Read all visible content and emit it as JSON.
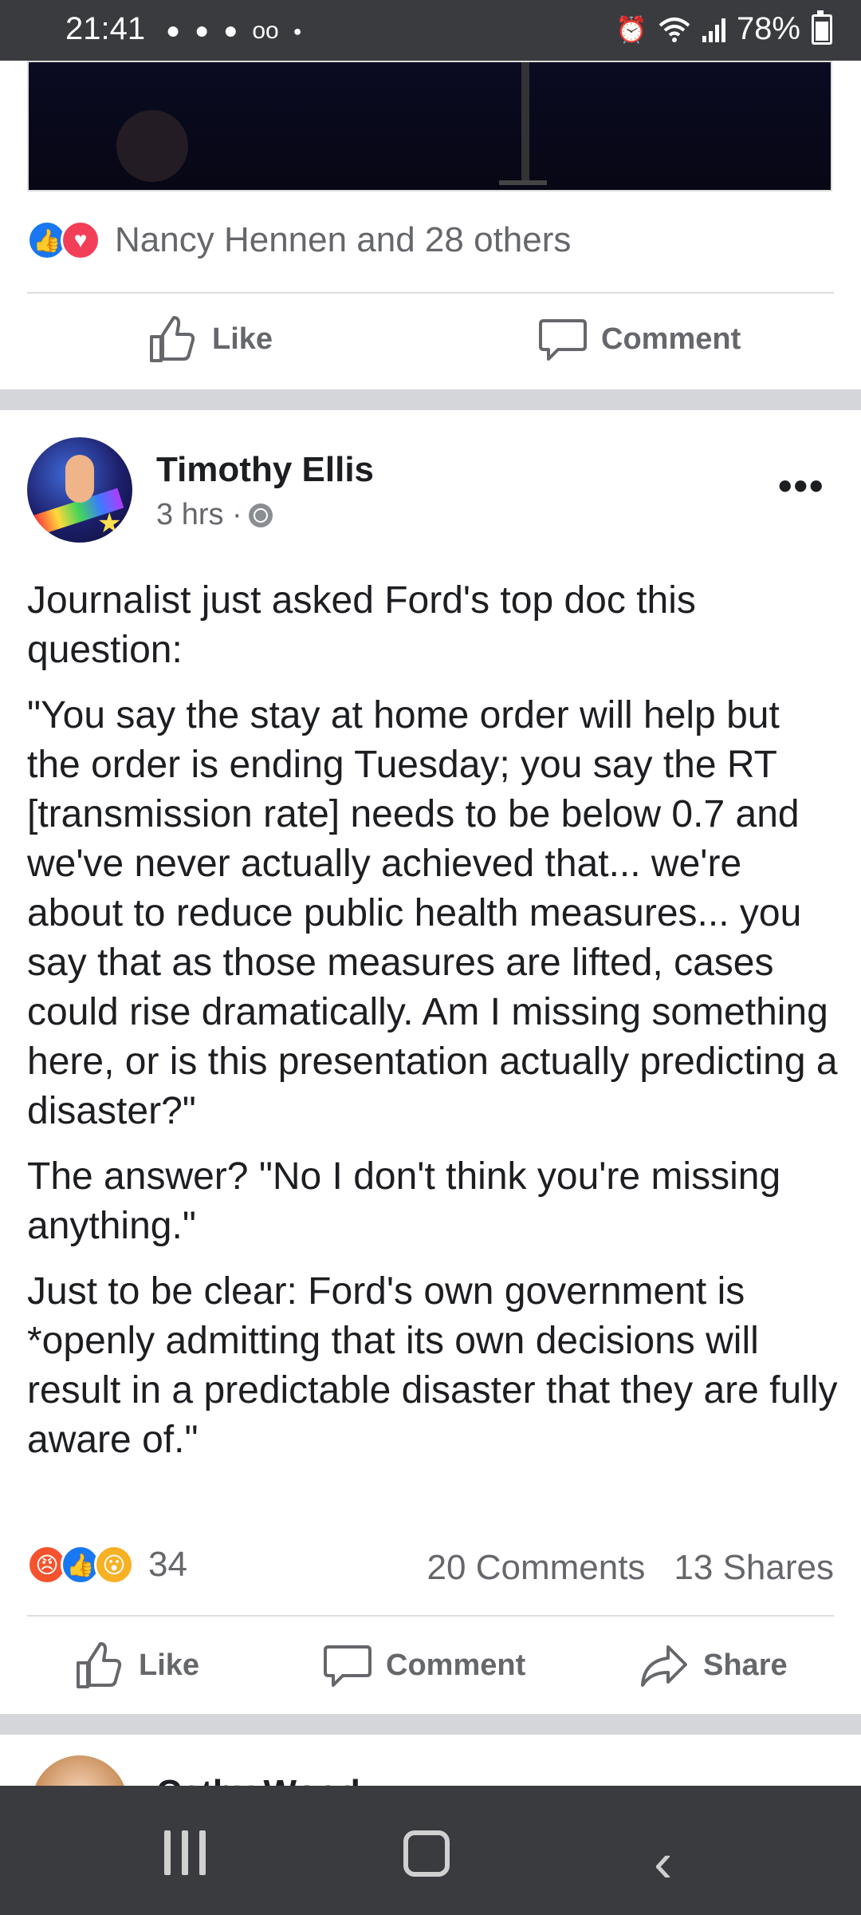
{
  "status_bar": {
    "time": "21:41",
    "notification_icons": [
      "chat-icon",
      "chat-icon",
      "chat-icon",
      "voicemail-icon",
      "dot-icon"
    ],
    "battery": "78%"
  },
  "prev_post": {
    "reaction_text": "Nancy Hennen and 28 others",
    "like_label": "Like",
    "comment_label": "Comment"
  },
  "post": {
    "author": "Timothy Ellis",
    "time": "3 hrs ·",
    "paragraphs": [
      "Journalist just asked Ford's top doc this question:",
      "\"You say the stay at home order will help but the order is ending Tuesday; you say the RT [transmission rate] needs to be below 0.7 and we've never actually achieved that... we're about to reduce public health measures... you say that as those measures are lifted, cases could rise dramatically. Am I missing something here, or is this presentation actually predicting a disaster?\"",
      "The answer? \"No I don't think you're missing anything.\"",
      "Just to be clear: Ford's own government is *openly admitting that its own decisions will result in a predictable disaster that they are fully aware of.\""
    ],
    "reaction_count": "34",
    "comments": "20 Comments",
    "shares": "13 Shares",
    "like_label": "Like",
    "comment_label": "Comment",
    "share_label": "Share"
  },
  "next_post": {
    "author_partial": "Cathy Wood"
  }
}
